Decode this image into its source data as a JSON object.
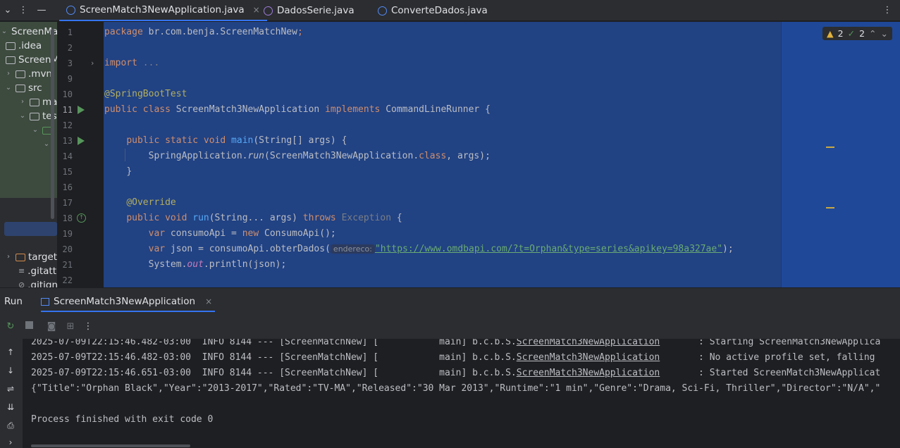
{
  "topbar": {
    "menu_icon": "ellipsis-vertical",
    "tabs": [
      {
        "label": "ScreenMatch3NewApplication.java",
        "icon": "java-class-icon",
        "active": true,
        "close": "×"
      },
      {
        "label": "DadosSerie.java",
        "icon": "java-record-icon",
        "active": false
      },
      {
        "label": "ConverteDados.java",
        "icon": "java-class-icon",
        "active": false
      }
    ]
  },
  "project": {
    "items": [
      {
        "label": "ScreenMat"
      },
      {
        "label": ".idea"
      },
      {
        "label": "ScreenM"
      },
      {
        "label": ".mvn"
      },
      {
        "label": "src"
      },
      {
        "label": "ma"
      },
      {
        "label": "tes"
      },
      {
        "label": "target"
      },
      {
        "label": ".gitatt"
      },
      {
        "label": ".gitign"
      }
    ]
  },
  "editor": {
    "inspections": {
      "warnings": "2",
      "ok": "2"
    },
    "lines": [
      {
        "n": "1"
      },
      {
        "n": "2"
      },
      {
        "n": "3"
      },
      {
        "n": "9"
      },
      {
        "n": "10"
      },
      {
        "n": "11"
      },
      {
        "n": "12"
      },
      {
        "n": "13"
      },
      {
        "n": "14"
      },
      {
        "n": "15"
      },
      {
        "n": "16"
      },
      {
        "n": "17"
      },
      {
        "n": "18"
      },
      {
        "n": "19"
      },
      {
        "n": "20"
      },
      {
        "n": "21"
      },
      {
        "n": "22"
      }
    ],
    "code": {
      "package_kw": "package",
      "package_name": " br.com.benja.ScreenMatchNew",
      "semi": ";",
      "import_kw": "import",
      "import_folded": " ...",
      "annotation_sbt": "@SpringBootTest",
      "public": "public",
      "class": "class",
      "class_name": "ScreenMatch3NewApplication",
      "implements": "implements",
      "iface": "CommandLineRunner",
      "open_brace": " {",
      "static": "static",
      "void": "void",
      "main": "main",
      "main_args": "(String[] args) {",
      "spring_app": "SpringApplication.",
      "run_call": "run",
      "run_args_a": "(ScreenMatch3NewApplication.",
      "class_kw": "class",
      "run_args_b": ", args);",
      "close_brace": "}",
      "override": "@Override",
      "run_method": "run",
      "run_params": "(String... args) ",
      "throws": "throws",
      "exception": " Exception",
      "var": "var",
      "consumo_decl": " consumoApi = ",
      "new": "new",
      "consumo_ctor": " ConsumoApi();",
      "json_decl": " json = consumoApi.obterDados(",
      "param_hint": "endereco:",
      "url": "\"https://www.omdbapi.com/?t=Orphan&type=series&apikey=98a327ae\"",
      "url_close": ");",
      "system": "System.",
      "out": "out",
      "println": ".println(json);"
    }
  },
  "run_panel": {
    "title": "Run",
    "tab_label": "ScreenMatch3NewApplication",
    "tab_close": "×",
    "console": [
      {
        "prefix": "2025-07-09T22:15:46.482-03:00  INFO 8144 --- [ScreenMatchNew] [           main] b.c.b.S.",
        "link": "ScreenMatch3NewApplication",
        "suffix": "       : Starting ScreenMatch3NewApplica"
      },
      {
        "prefix": "2025-07-09T22:15:46.482-03:00  INFO 8144 --- [ScreenMatchNew] [           main] b.c.b.S.",
        "link": "ScreenMatch3NewApplication",
        "suffix": "       : No active profile set, falling"
      },
      {
        "prefix": "2025-07-09T22:15:46.651-03:00  INFO 8144 --- [ScreenMatchNew] [           main] b.c.b.S.",
        "link": "ScreenMatch3NewApplication",
        "suffix": "       : Started ScreenMatch3NewApplicat"
      },
      {
        "text": "{\"Title\":\"Orphan Black\",\"Year\":\"2013-2017\",\"Rated\":\"TV-MA\",\"Released\":\"30 Mar 2013\",\"Runtime\":\"1 min\",\"Genre\":\"Drama, Sci-Fi, Thriller\",\"Director\":\"N/A\",\""
      },
      {
        "text": "Process finished with exit code 0"
      }
    ]
  }
}
